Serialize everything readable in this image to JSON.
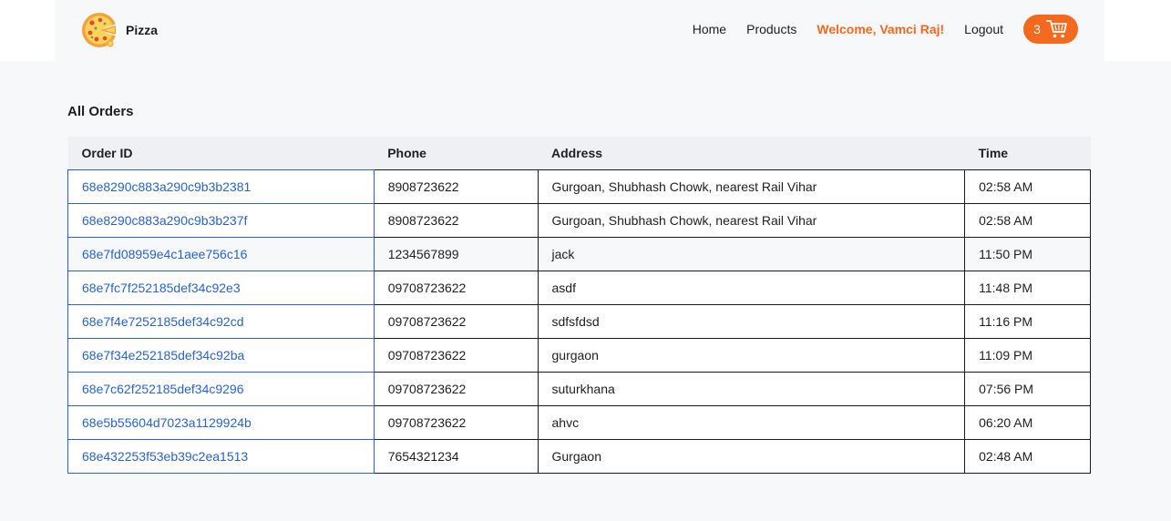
{
  "brand": {
    "name": "Pizza",
    "logo_icon": "pizza-icon"
  },
  "nav": {
    "home": "Home",
    "products": "Products",
    "welcome": "Welcome, Vamci Raj!",
    "logout": "Logout",
    "cart_count": "3",
    "cart_icon": "shopping-cart-icon"
  },
  "colors": {
    "accent": "#f5691f",
    "link": "#2a63cc",
    "page_bg": "#f7f8fa",
    "header_row_bg": "#eff0f3"
  },
  "orders": {
    "title": "All Orders",
    "columns": {
      "order_id": "Order ID",
      "phone": "Phone",
      "address": "Address",
      "time": "Time"
    },
    "rows": [
      {
        "order_id": "68e8290c883a290c9b3b2381",
        "phone": "8908723622",
        "address": "Gurgoan, Shubhash Chowk, nearest Rail Vihar",
        "time": "02:58 AM"
      },
      {
        "order_id": "68e8290c883a290c9b3b237f",
        "phone": "8908723622",
        "address": "Gurgoan, Shubhash Chowk, nearest Rail Vihar",
        "time": "02:58 AM"
      },
      {
        "order_id": "68e7fd08959e4c1aee756c16",
        "phone": "1234567899",
        "address": "jack",
        "time": "11:50 PM"
      },
      {
        "order_id": "68e7fc7f252185def34c92e3",
        "phone": "09708723622",
        "address": "asdf",
        "time": "11:48 PM"
      },
      {
        "order_id": "68e7f4e7252185def34c92cd",
        "phone": "09708723622",
        "address": "sdfsfdsd",
        "time": "11:16 PM"
      },
      {
        "order_id": "68e7f34e252185def34c92ba",
        "phone": "09708723622",
        "address": "gurgaon",
        "time": "11:09 PM"
      },
      {
        "order_id": "68e7c62f252185def34c9296",
        "phone": "09708723622",
        "address": "suturkhana",
        "time": "07:56 PM"
      },
      {
        "order_id": "68e5b55604d7023a1129924b",
        "phone": "09708723622",
        "address": "ahvc",
        "time": "06:20 AM"
      },
      {
        "order_id": "68e432253f53eb39c2ea1513",
        "phone": "7654321234",
        "address": "Gurgaon",
        "time": "02:48 AM"
      }
    ]
  }
}
